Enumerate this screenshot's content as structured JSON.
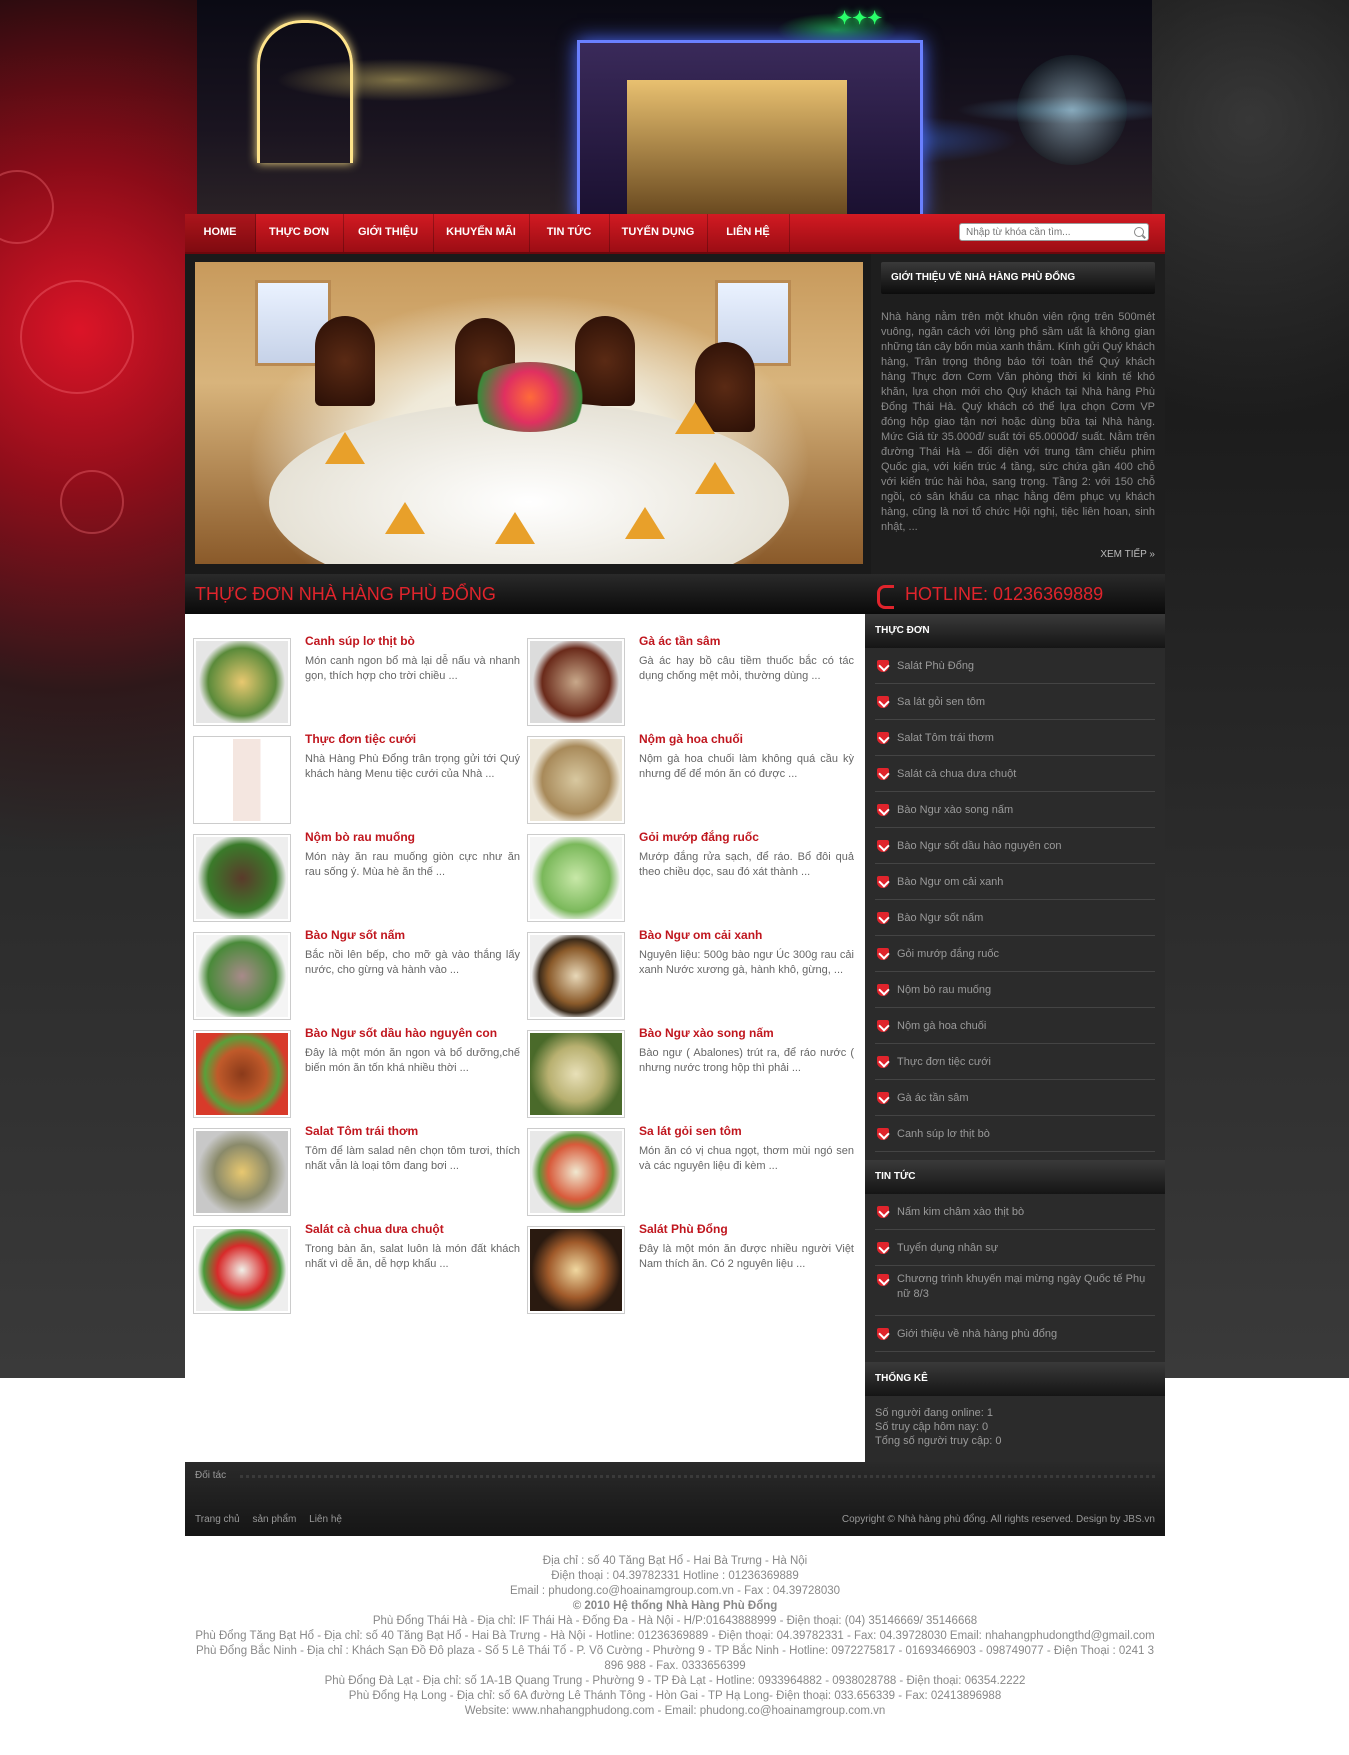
{
  "nav": {
    "items": [
      "HOME",
      "THỰC ĐƠN",
      "GIỚI THIỆU",
      "KHUYẾN MÃI",
      "TIN TỨC",
      "TUYỂN DỤNG",
      "LIÊN HỆ"
    ],
    "search_placeholder": "Nhập từ khóa cần tìm..."
  },
  "intro": {
    "heading": "GIỚI THIỆU VỀ NHÀ HÀNG PHÙ ĐỔNG",
    "text": "Nhà hàng nằm trên một khuôn viên rộng trên 500mét vuông, ngăn cách với lòng phố sầm uất là không gian những tán cây bốn mùa xanh thẫm. Kính gửi Quý khách hàng, Trân trọng thông báo tới toàn thể Quý khách hàng Thực đơn Cơm Văn phòng thời kì kinh tế khó khăn, lựa chọn mới cho Quý khách tại Nhà hàng Phù Đổng Thái Hà. Quý khách có thể lựa chọn Cơm VP đóng hộp giao tận nơi hoặc dùng bữa tại Nhà hàng. Mức Giá từ 35.000đ/ suất tới 65.0000đ/ suất. Nằm trên đường Thái Hà – đối diện với trung tâm chiếu phim Quốc gia, với kiến trúc 4 tầng, sức chứa gần 400 chỗ với kiến trúc hài hòa, sang trọng. Tầng 2: với 150 chỗ ngồi, có sân khấu ca nhạc hằng đêm phục vụ khách hàng, cũng là nơi tổ chức Hội nghị, tiệc liên hoan, sinh nhật, ...",
    "more": "XEM TIẾP »"
  },
  "menu": {
    "heading": "THỰC ĐƠN NHÀ HÀNG PHÙ ĐỔNG",
    "items": [
      {
        "title": "Canh súp lơ thịt bò",
        "desc": "Món canh ngon bổ mà lại dễ nấu và nhanh gọn, thích hợp cho trời chiều ..."
      },
      {
        "title": "Gà ác tần sâm",
        "desc": "Gà ác hay bồ câu tiềm thuốc bắc có tác dụng chống mệt mỏi, thường dùng ..."
      },
      {
        "title": "Thực đơn tiệc cưới",
        "desc": "Nhà Hàng Phù Đổng trân trọng gửi tới Quý khách hàng Menu tiệc cưới của Nhà ..."
      },
      {
        "title": "Nộm gà hoa chuối",
        "desc": "Nộm gà hoa chuối làm không quá cầu kỳ nhưng để để món ăn có được ..."
      },
      {
        "title": "Nộm bò rau muống",
        "desc": "Món này ăn rau muống giòn cực như ăn rau sống ý. Mùa hè ăn thế ..."
      },
      {
        "title": "Gỏi mướp đắng ruốc",
        "desc": "Mướp đắng rửa sạch, để ráo. Bổ đôi quả theo chiều dọc, sau đó xát thành ..."
      },
      {
        "title": "Bào Ngư sốt nấm",
        "desc": "Bắc nồi lên bếp, cho mỡ gà vào thắng lấy nước, cho gừng và hành vào ..."
      },
      {
        "title": "Bào Ngư om cải xanh",
        "desc": "Nguyên liệu: 500g bào ngư Úc 300g rau cải xanh Nước xương gà, hành khô, gừng, ..."
      },
      {
        "title": "Bào Ngư sốt dầu hào nguyên con",
        "desc": "Đây là một món ăn ngon và bổ dưỡng,chế biến món ăn tốn khá nhiều thời ..."
      },
      {
        "title": "Bào Ngư xào song nấm",
        "desc": "Bào ngư ( Abalones) trút ra, để ráo nước ( nhưng nước trong hộp thì phải ..."
      },
      {
        "title": "Salat Tôm trái thơm",
        "desc": "Tôm để làm salad nên chọn tôm tươi, thích nhất vẫn là loại tôm đang bơi ..."
      },
      {
        "title": "Sa lát gỏi sen tôm",
        "desc": "Món ăn có vị chua ngọt, thơm mùi ngó sen và các nguyên liệu đi kèm ..."
      },
      {
        "title": "Salát cà chua dưa chuột",
        "desc": "Trong bàn ăn, salat luôn là món đất khách nhất vì dễ ăn, dễ hợp khẩu ..."
      },
      {
        "title": "Salát Phù Đổng",
        "desc": "Đây là một món ăn được nhiều người Việt Nam thích ăn. Có 2 nguyên liệu ..."
      }
    ]
  },
  "sidebar": {
    "hotline": "HOTLINE: 01236369889",
    "menu_heading": "THỰC ĐƠN",
    "menu_links": [
      "Salát Phù Đổng",
      "Sa lát gỏi sen tôm",
      "Salat Tôm trái thơm",
      "Salát cà chua dưa chuột",
      "Bào Ngư xào song nấm",
      "Bào Ngư sốt dầu hào nguyên con",
      "Bào Ngư om cải xanh",
      "Bào Ngư sốt nấm",
      "Gỏi mướp đắng ruốc",
      "Nộm bò rau muống",
      "Nộm gà hoa chuối",
      "Thực đơn tiệc cưới",
      "Gà ác tần sâm",
      "Canh súp lơ thịt bò"
    ],
    "news_heading": "TIN TỨC",
    "news_links": [
      "Nấm kim châm xào thịt bò",
      "Tuyển dụng nhân sự",
      "Chương trình khuyến mại mừng ngày Quốc tế Phụ nữ 8/3",
      "Giới thiệu về nhà hàng phù đổng"
    ],
    "stats_heading": "THỐNG KÊ",
    "stats": [
      "Số người đang online: 1",
      "Số truy cập hôm nay: 0",
      "Tổng số người truy cập: 0"
    ]
  },
  "footer": {
    "partner": "Đối tác",
    "links": [
      "Trang chủ",
      "sản phẩm",
      "Liên hệ"
    ],
    "copyright": "Copyright © Nhà hàng phù đổng. All rights reserved. Design by JBS.vn",
    "address_lines": [
      "Địa chỉ : số 40 Tăng Bạt Hổ - Hai Bà Trưng - Hà Nội",
      "Điện thoại : 04.39782331 Hotline : 01236369889",
      "Email : phudong.co@hoainamgroup.com.vn - Fax : 04.39728030",
      "© 2010 Hệ thống Nhà Hàng Phù Đổng",
      "Phù Đổng Thái Hà - Địa chỉ: IF Thái Hà - Đống Đa - Hà Nội - H/P:01643888999 - Điện thoại: (04) 35146669/ 35146668",
      "Phù Đổng Tăng Bạt Hổ - Địa chỉ: số 40 Tăng Bạt Hổ - Hai Bà Trưng - Hà Nội - Hotline: 01236369889 - Điện thoại: 04.39782331 - Fax: 04.39728030 Email: nhahangphudongthd@gmail.com",
      "Phù Đổng Bắc Ninh - Địa chỉ : Khách Sạn Đồ Đô plaza - Số 5 Lê Thái Tổ - P. Võ Cường - Phường 9 - TP Bắc Ninh - Hotline: 0972275817 - 01693466903 - 098749077 - Điện Thoại : 0241 3 896 988 - Fax. 0333656399",
      "Phù Đổng Đà Lạt - Địa chỉ: số 1A-1B Quang Trung - Phường 9 - TP Đà Lạt - Hotline: 0933964882 - 0938028788 - Điện thoại: 06354.2222",
      "Phù Đổng Hạ Long - Địa chỉ: số 6A đường Lê Thánh Tông - Hòn Gai - TP Hạ Long- Điện thoại: 033.656339 - Fax: 02413896988",
      "Website: www.nhahangphudong.com - Email: phudong.co@hoainamgroup.com.vn"
    ]
  },
  "colors": {
    "accent": "#e0242c",
    "nav_red": "#c4161e",
    "title_red": "#c0161e"
  }
}
